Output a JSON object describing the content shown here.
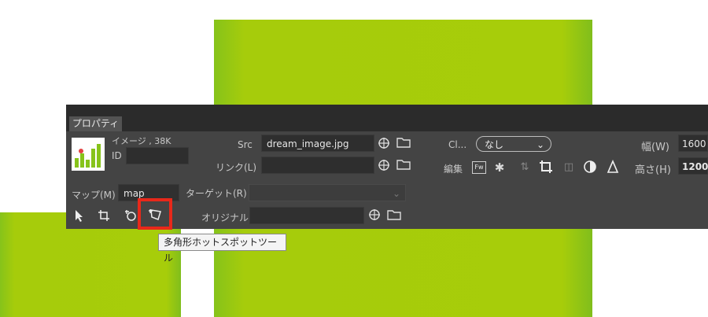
{
  "panel": {
    "tab_label": "プロパティ",
    "image_info": "イメージ , 38K",
    "id_label": "ID",
    "id_value": "",
    "src_label": "Src",
    "src_value": "dream_image.jpg",
    "link_label": "リンク(L)",
    "link_value": "",
    "class_label": "Cl...",
    "class_value": "なし",
    "edit_label": "編集",
    "fw_label": "Fw",
    "width_label": "幅(W)",
    "width_value": "1600",
    "height_label": "高さ(H)",
    "height_value": "1200",
    "map_label": "マップ(M)",
    "map_value": "map",
    "target_label": "ターゲット(R)",
    "target_value": "",
    "original_label": "オリジナル",
    "original_value": ""
  },
  "tooltip": {
    "text": "多角形ホットスポットツール"
  },
  "colors": {
    "green": "#a7cd0a",
    "highlight": "#e8281a",
    "panel_bg": "#444444"
  }
}
